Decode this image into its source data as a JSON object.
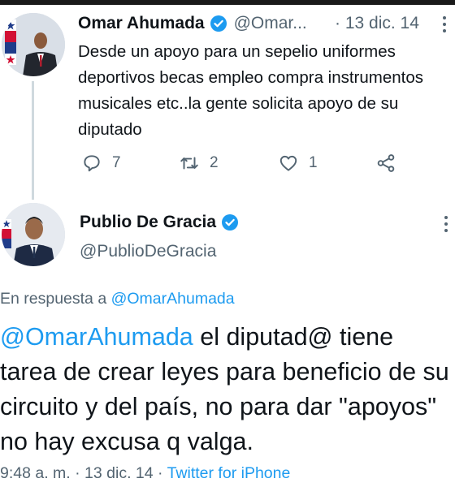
{
  "parent_tweet": {
    "author_name": "Omar Ahumada",
    "handle_truncated": "@Omar...",
    "time": "· 13 dic. 14",
    "text": "Desde un apoyo para un sepelio uniformes deportivos becas empleo compra instrumentos musicales etc..la gente solicita apoyo de su diputado",
    "counts": {
      "replies": "7",
      "retweets": "2",
      "likes": "1"
    }
  },
  "main_tweet": {
    "author_name": "Publio De Gracia",
    "handle": "@PublioDeGracia",
    "replying_prefix": "En respuesta a",
    "replying_to": "@OmarAhumada",
    "text_mention": "@OmarAhumada",
    "text_rest": " el diputad@ tiene tarea de crear leyes para beneficio de su circuito y del país, no para dar \"apoyos\" no hay excusa q valga.",
    "time": "9:48 a. m. · 13 dic. 14 · ",
    "source": "Twitter for iPhone"
  },
  "icons": {
    "verified": "verified-badge-icon",
    "reply": "speech-bubble-icon",
    "retweet": "retweet-icon",
    "like": "heart-icon",
    "share": "share-nodes-icon",
    "more": "more-vertical-icon"
  },
  "colors": {
    "accent": "#1d9bf0",
    "text": "#0f1419",
    "muted": "#536471",
    "thread_line": "#cfd9de"
  }
}
